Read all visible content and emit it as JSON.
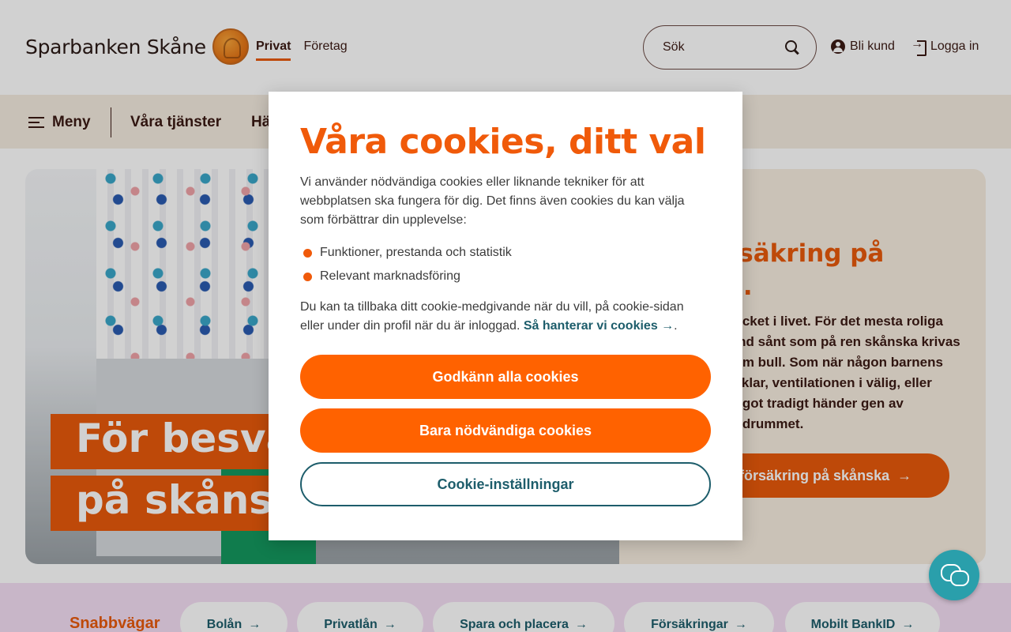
{
  "header": {
    "logo_text": "Sparbanken Skåne",
    "segments": [
      "Privat",
      "Företag"
    ],
    "search_placeholder": "Sök",
    "become_customer": "Bli kund",
    "login": "Logga in"
  },
  "subnav": {
    "menu": "Meny",
    "items": [
      "Våra tjänster",
      "Hä"
    ]
  },
  "hero": {
    "headline_line1": "För besvä",
    "headline_line2": "på skånsk",
    "card_title_line1": "rsäkring på",
    "card_title_line2": "a.",
    "card_text": "nycket i livet. För det mesta roliga land sånt som på ren skånska krivas som bull. Som när någon barnens cyklar, ventilationen i välig, eller något tradigt händer gen av badrummet.",
    "cta": "försäkring på skånska",
    "cta_arrow": "→"
  },
  "quicklinks": {
    "label": "Snabbvägar",
    "items": [
      "Bolån",
      "Privatlån",
      "Spara och placera",
      "Försäkringar",
      "Mobilt BankID"
    ],
    "arrow": "→"
  },
  "cookie_modal": {
    "title": "Våra cookies, ditt val",
    "intro": "Vi använder nödvändiga cookies eller liknande tekniker för att webbplatsen ska fungera för dig. Det finns även cookies du kan välja som förbättrar din upplevelse:",
    "list": [
      "Funktioner, prestanda och statistik",
      "Relevant marknadsföring"
    ],
    "outro": "Du kan ta tillbaka ditt cookie-medgivande när du vill, på cookie-sidan eller under din profil när du är inloggad.",
    "link": "Så hanterar vi cookies →",
    "buttons": {
      "accept_all": "Godkänn alla cookies",
      "necessary_only": "Bara nödvändiga cookies",
      "settings": "Cookie-inställningar"
    }
  },
  "colors": {
    "brand_orange": "#f05a0a",
    "teal": "#1d5d6b",
    "chat": "#2a9fab"
  }
}
